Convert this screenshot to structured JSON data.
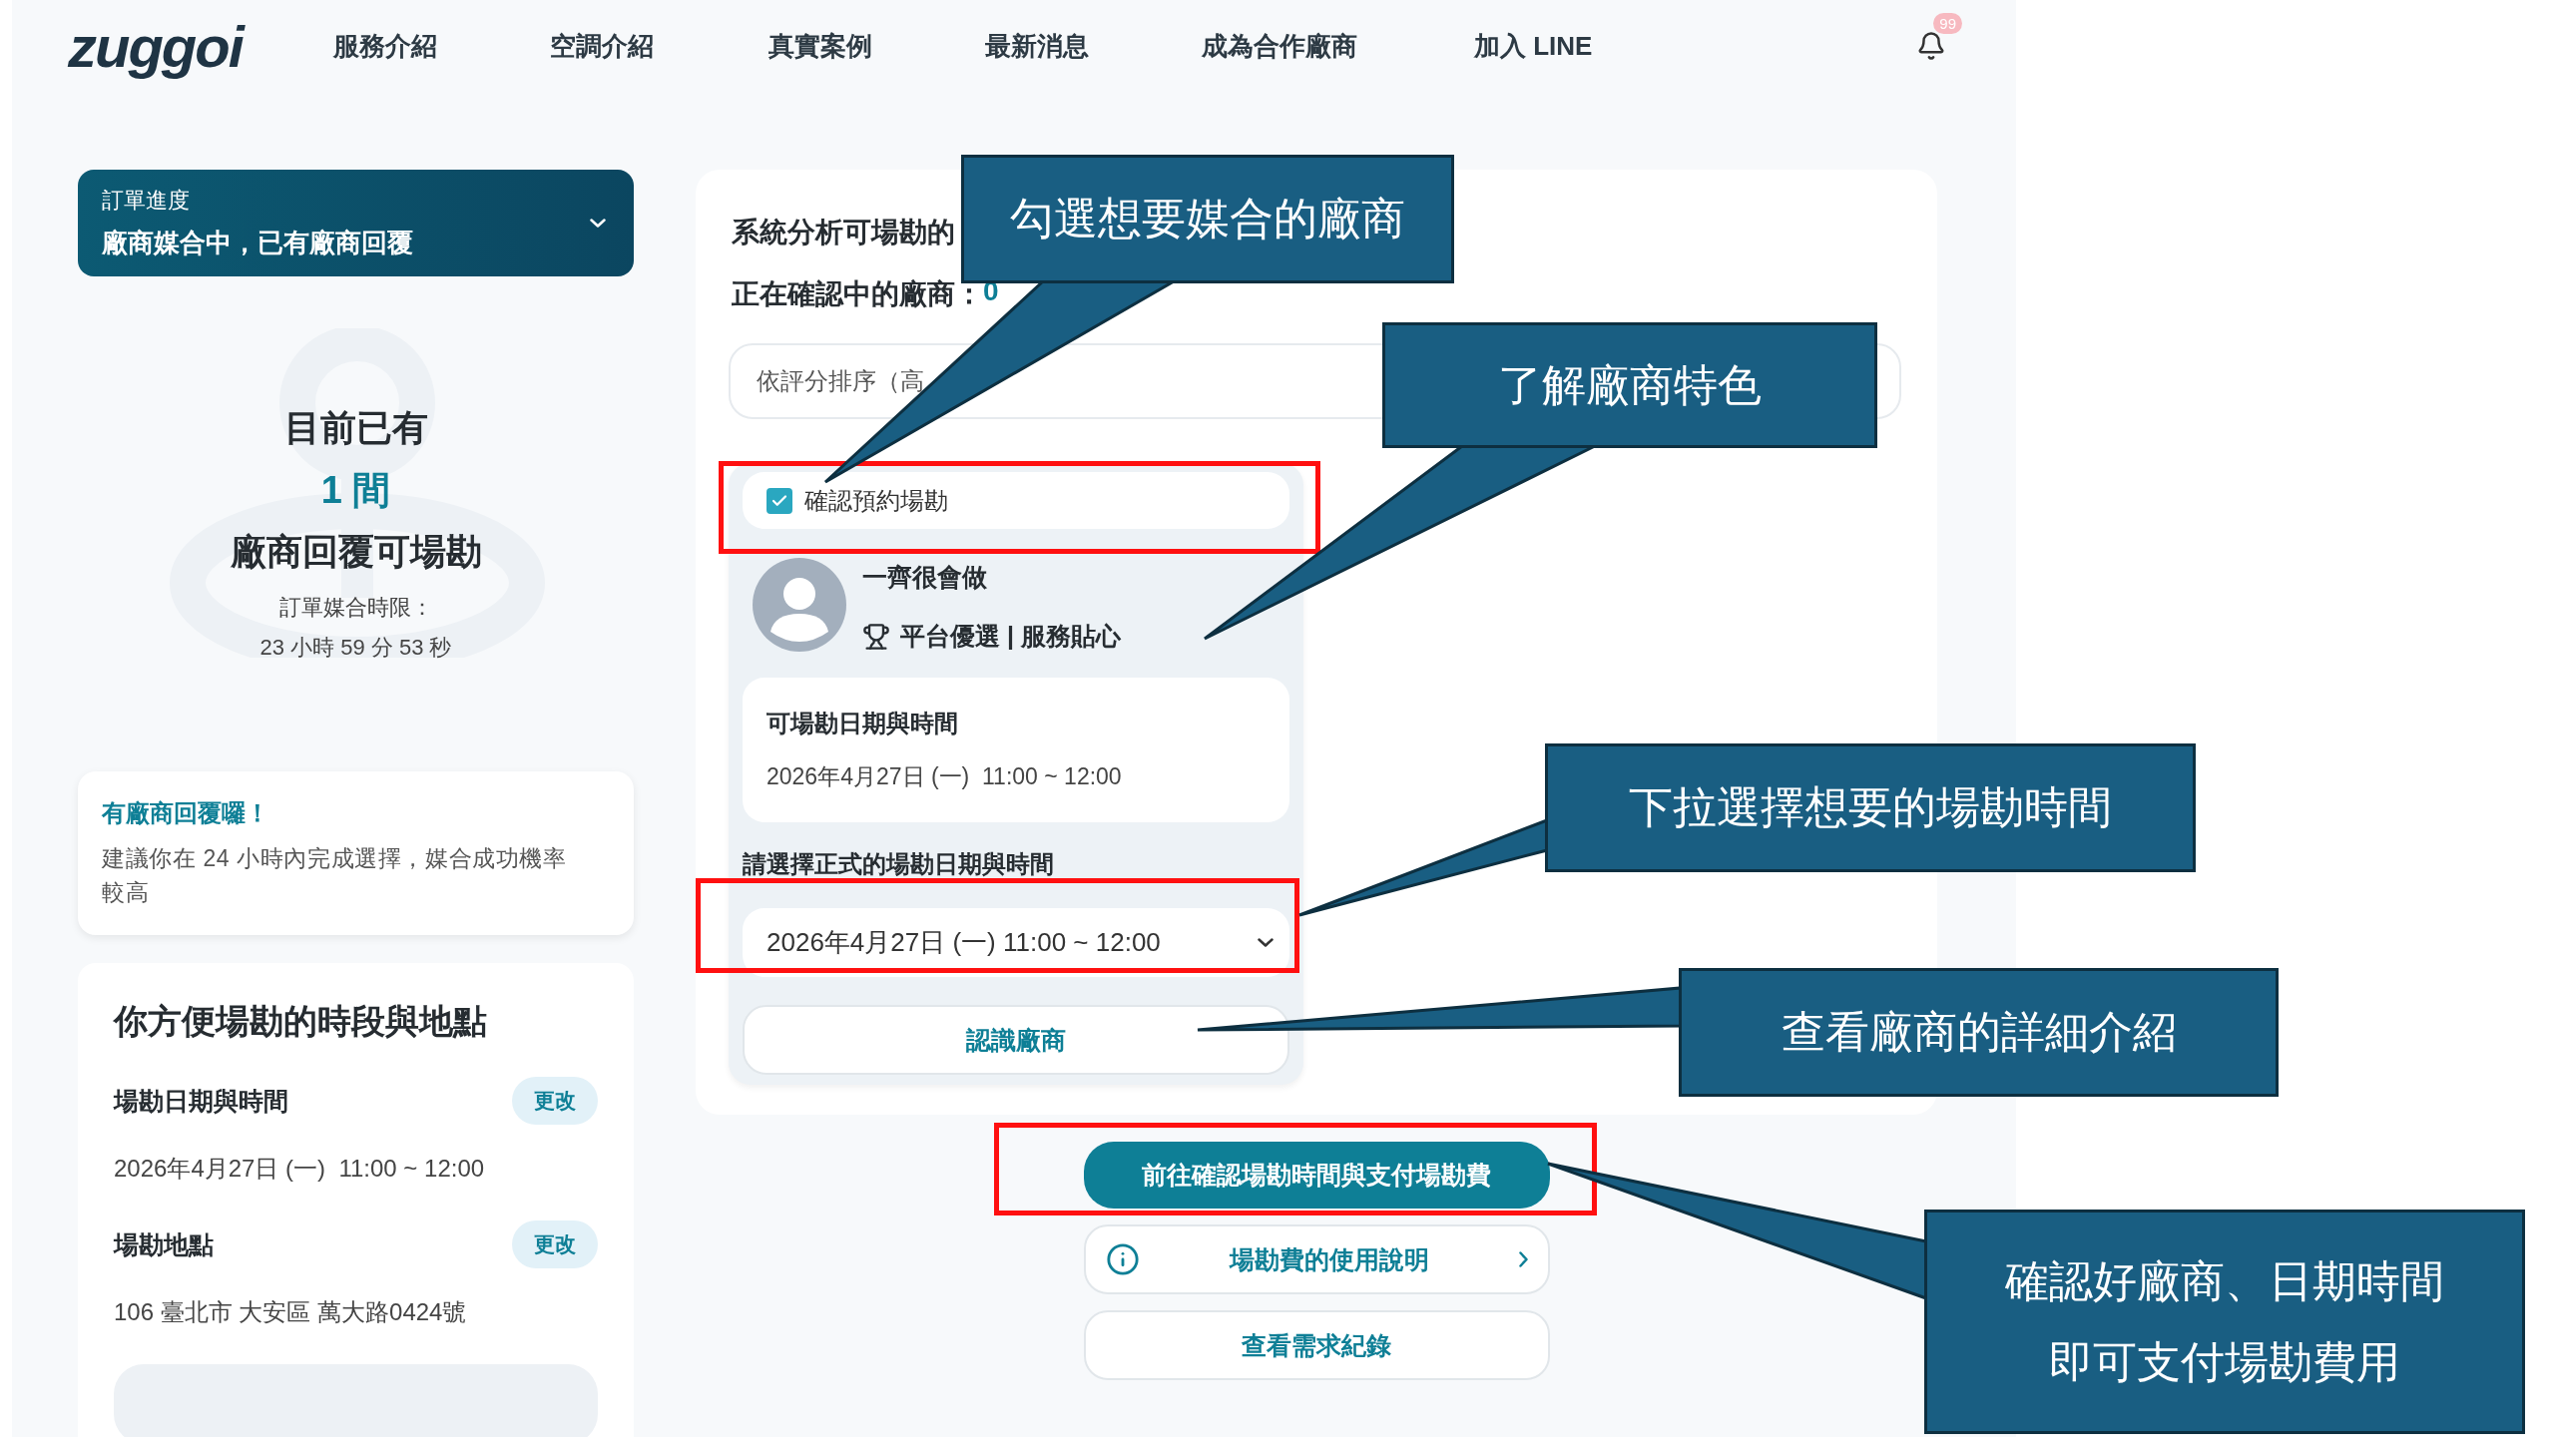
{
  "nav": {
    "logo": "zuggoi",
    "items": [
      "服務介紹",
      "空調介紹",
      "真實案例",
      "最新消息",
      "成為合作廠商",
      "加入 LINE"
    ],
    "notification_badge": "99"
  },
  "order_progress": {
    "label": "訂單進度",
    "status": "廠商媒合中，已有廠商回覆",
    "expanded": false
  },
  "summary": {
    "intro": "目前已有",
    "count": "1 間",
    "outro": "廠商回覆可場勘",
    "deadline_label": "訂單媒合時限：",
    "deadline": "23 小時 59 分 53 秒"
  },
  "notice": {
    "title": "有廠商回覆囉！",
    "body": "建議你在 24 小時內完成選擇，媒合成功機率較高"
  },
  "schedule": {
    "title": "你方便場勘的時段與地點",
    "sections": [
      {
        "label": "場勘日期與時間",
        "value": "2026年4月27日 (一)  11:00 ~ 12:00",
        "action": "更改"
      },
      {
        "label": "場勘地點",
        "value": "106 臺北市 大安區 萬大路0424號",
        "action": "更改"
      }
    ]
  },
  "matching": {
    "heading": "系統分析可場勘的",
    "counter_label": "正在確認中的廠商：",
    "counter_value": "0",
    "sort": "依評分排序（高",
    "vendor": {
      "confirm": {
        "label": "確認預約場勘",
        "checked": true
      },
      "name": "一齊很會做",
      "badges": "平台優選 | 服務貼心",
      "available_label": "可場勘日期與時間",
      "available_value": "2026年4月27日 (一)  11:00 ~ 12:00",
      "select_label": "請選擇正式的場勘日期與時間",
      "select_value": "2026年4月27日 (一) 11:00 ~ 12:00",
      "details_button": "認識廠商"
    }
  },
  "actions": {
    "primary": "前往確認場勘時間與支付場勘費",
    "info": "場勘費的使用說明",
    "history": "查看需求紀錄"
  },
  "callouts": [
    {
      "lines": [
        "勾選想要媒合的廠商"
      ]
    },
    {
      "lines": [
        "了解廠商特色"
      ]
    },
    {
      "lines": [
        "下拉選擇想要的場勘時間"
      ]
    },
    {
      "lines": [
        "查看廠商的詳細介紹"
      ]
    },
    {
      "lines": [
        "確認好廠商、日期時間",
        "即可支付場勘費用"
      ]
    }
  ]
}
